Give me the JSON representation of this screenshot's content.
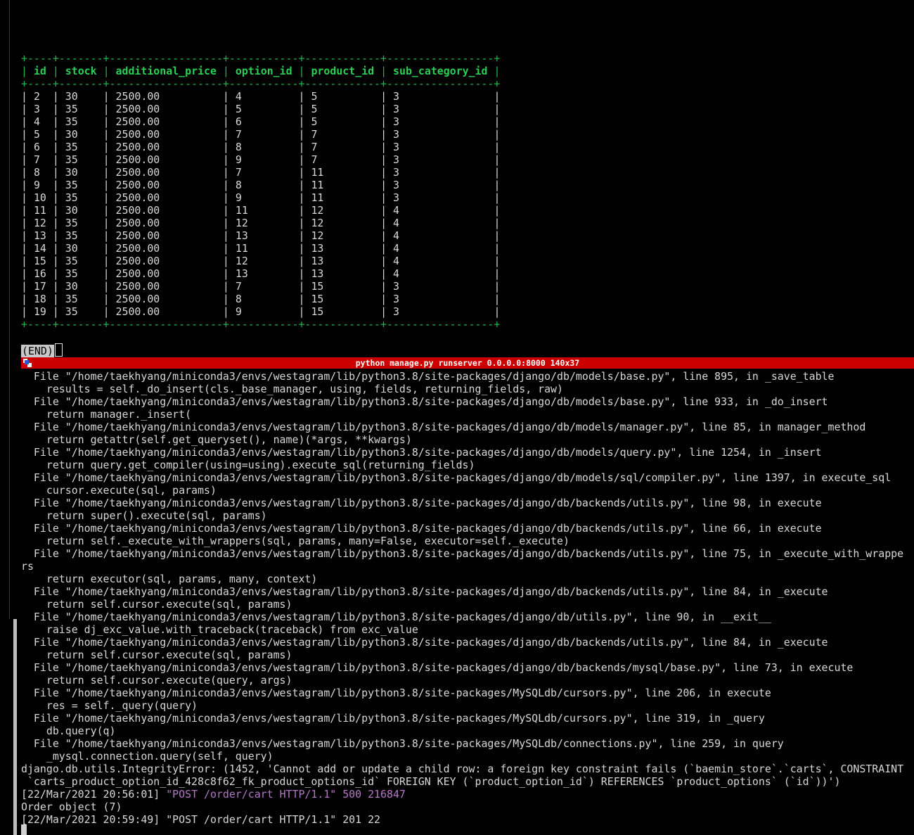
{
  "window": {
    "pane_title": "python manage.py runserver 0.0.0.0:8000 140x37"
  },
  "table": {
    "border": "+----+-------+------------------+-----------+------------+-----------------+",
    "columns": [
      "id",
      "stock",
      "additional_price",
      "option_id",
      "product_id",
      "sub_category_id"
    ],
    "widths": [
      2,
      5,
      16,
      9,
      10,
      15
    ],
    "rows": [
      [
        "2",
        "30",
        "2500.00",
        "4",
        "5",
        "3"
      ],
      [
        "3",
        "35",
        "2500.00",
        "5",
        "5",
        "3"
      ],
      [
        "4",
        "35",
        "2500.00",
        "6",
        "5",
        "3"
      ],
      [
        "5",
        "30",
        "2500.00",
        "7",
        "7",
        "3"
      ],
      [
        "6",
        "35",
        "2500.00",
        "8",
        "7",
        "3"
      ],
      [
        "7",
        "35",
        "2500.00",
        "9",
        "7",
        "3"
      ],
      [
        "8",
        "30",
        "2500.00",
        "7",
        "11",
        "3"
      ],
      [
        "9",
        "35",
        "2500.00",
        "8",
        "11",
        "3"
      ],
      [
        "10",
        "35",
        "2500.00",
        "9",
        "11",
        "3"
      ],
      [
        "11",
        "30",
        "2500.00",
        "11",
        "12",
        "4"
      ],
      [
        "12",
        "35",
        "2500.00",
        "12",
        "12",
        "4"
      ],
      [
        "13",
        "35",
        "2500.00",
        "13",
        "12",
        "4"
      ],
      [
        "14",
        "30",
        "2500.00",
        "11",
        "13",
        "4"
      ],
      [
        "15",
        "35",
        "2500.00",
        "12",
        "13",
        "4"
      ],
      [
        "16",
        "35",
        "2500.00",
        "13",
        "13",
        "4"
      ],
      [
        "17",
        "30",
        "2500.00",
        "7",
        "15",
        "3"
      ],
      [
        "18",
        "35",
        "2500.00",
        "8",
        "15",
        "3"
      ],
      [
        "19",
        "35",
        "2500.00",
        "9",
        "15",
        "3"
      ]
    ]
  },
  "pager": {
    "end_label": "(END)"
  },
  "log": [
    {
      "text": "  File \"/home/taekhyang/miniconda3/envs/westagram/lib/python3.8/site-packages/django/db/models/base.py\", line 895, in _save_table"
    },
    {
      "text": "    results = self._do_insert(cls._base_manager, using, fields, returning_fields, raw)"
    },
    {
      "text": "  File \"/home/taekhyang/miniconda3/envs/westagram/lib/python3.8/site-packages/django/db/models/base.py\", line 933, in _do_insert"
    },
    {
      "text": "    return manager._insert("
    },
    {
      "text": "  File \"/home/taekhyang/miniconda3/envs/westagram/lib/python3.8/site-packages/django/db/models/manager.py\", line 85, in manager_method"
    },
    {
      "text": "    return getattr(self.get_queryset(), name)(*args, **kwargs)"
    },
    {
      "text": "  File \"/home/taekhyang/miniconda3/envs/westagram/lib/python3.8/site-packages/django/db/models/query.py\", line 1254, in _insert"
    },
    {
      "text": "    return query.get_compiler(using=using).execute_sql(returning_fields)"
    },
    {
      "text": "  File \"/home/taekhyang/miniconda3/envs/westagram/lib/python3.8/site-packages/django/db/models/sql/compiler.py\", line 1397, in execute_sql"
    },
    {
      "text": "    cursor.execute(sql, params)"
    },
    {
      "text": "  File \"/home/taekhyang/miniconda3/envs/westagram/lib/python3.8/site-packages/django/db/backends/utils.py\", line 98, in execute"
    },
    {
      "text": "    return super().execute(sql, params)"
    },
    {
      "text": "  File \"/home/taekhyang/miniconda3/envs/westagram/lib/python3.8/site-packages/django/db/backends/utils.py\", line 66, in execute"
    },
    {
      "text": "    return self._execute_with_wrappers(sql, params, many=False, executor=self._execute)"
    },
    {
      "text": "  File \"/home/taekhyang/miniconda3/envs/westagram/lib/python3.8/site-packages/django/db/backends/utils.py\", line 75, in _execute_with_wrappe"
    },
    {
      "text": "rs"
    },
    {
      "text": "    return executor(sql, params, many, context)"
    },
    {
      "text": "  File \"/home/taekhyang/miniconda3/envs/westagram/lib/python3.8/site-packages/django/db/backends/utils.py\", line 84, in _execute"
    },
    {
      "text": "    return self.cursor.execute(sql, params)"
    },
    {
      "text": "  File \"/home/taekhyang/miniconda3/envs/westagram/lib/python3.8/site-packages/django/db/utils.py\", line 90, in __exit__"
    },
    {
      "text": "    raise dj_exc_value.with_traceback(traceback) from exc_value"
    },
    {
      "text": "  File \"/home/taekhyang/miniconda3/envs/westagram/lib/python3.8/site-packages/django/db/backends/utils.py\", line 84, in _execute"
    },
    {
      "text": "    return self.cursor.execute(sql, params)"
    },
    {
      "text": "  File \"/home/taekhyang/miniconda3/envs/westagram/lib/python3.8/site-packages/django/db/backends/mysql/base.py\", line 73, in execute"
    },
    {
      "text": "    return self.cursor.execute(query, args)"
    },
    {
      "text": "  File \"/home/taekhyang/miniconda3/envs/westagram/lib/python3.8/site-packages/MySQLdb/cursors.py\", line 206, in execute"
    },
    {
      "text": "    res = self._query(query)"
    },
    {
      "text": "  File \"/home/taekhyang/miniconda3/envs/westagram/lib/python3.8/site-packages/MySQLdb/cursors.py\", line 319, in _query"
    },
    {
      "text": "    db.query(q)"
    },
    {
      "text": "  File \"/home/taekhyang/miniconda3/envs/westagram/lib/python3.8/site-packages/MySQLdb/connections.py\", line 259, in query"
    },
    {
      "text": "    _mysql.connection.query(self, query)"
    },
    {
      "text": "django.db.utils.IntegrityError: (1452, 'Cannot add or update a child row: a foreign key constraint fails (`baemin_store`.`carts`, CONSTRAINT"
    },
    {
      "text": " `carts_product_option_id_428c8f62_fk_product_options_id` FOREIGN KEY (`product_option_id`) REFERENCES `product_options` (`id`))')"
    },
    {
      "prefix": "[22/Mar/2021 20:56:01] ",
      "highlight": "\"POST /order/cart HTTP/1.1\" 500 216847"
    },
    {
      "text": "Order object (7)"
    },
    {
      "text": "[22/Mar/2021 20:59:49] \"POST /order/cart HTTP/1.1\" 201 22"
    }
  ]
}
